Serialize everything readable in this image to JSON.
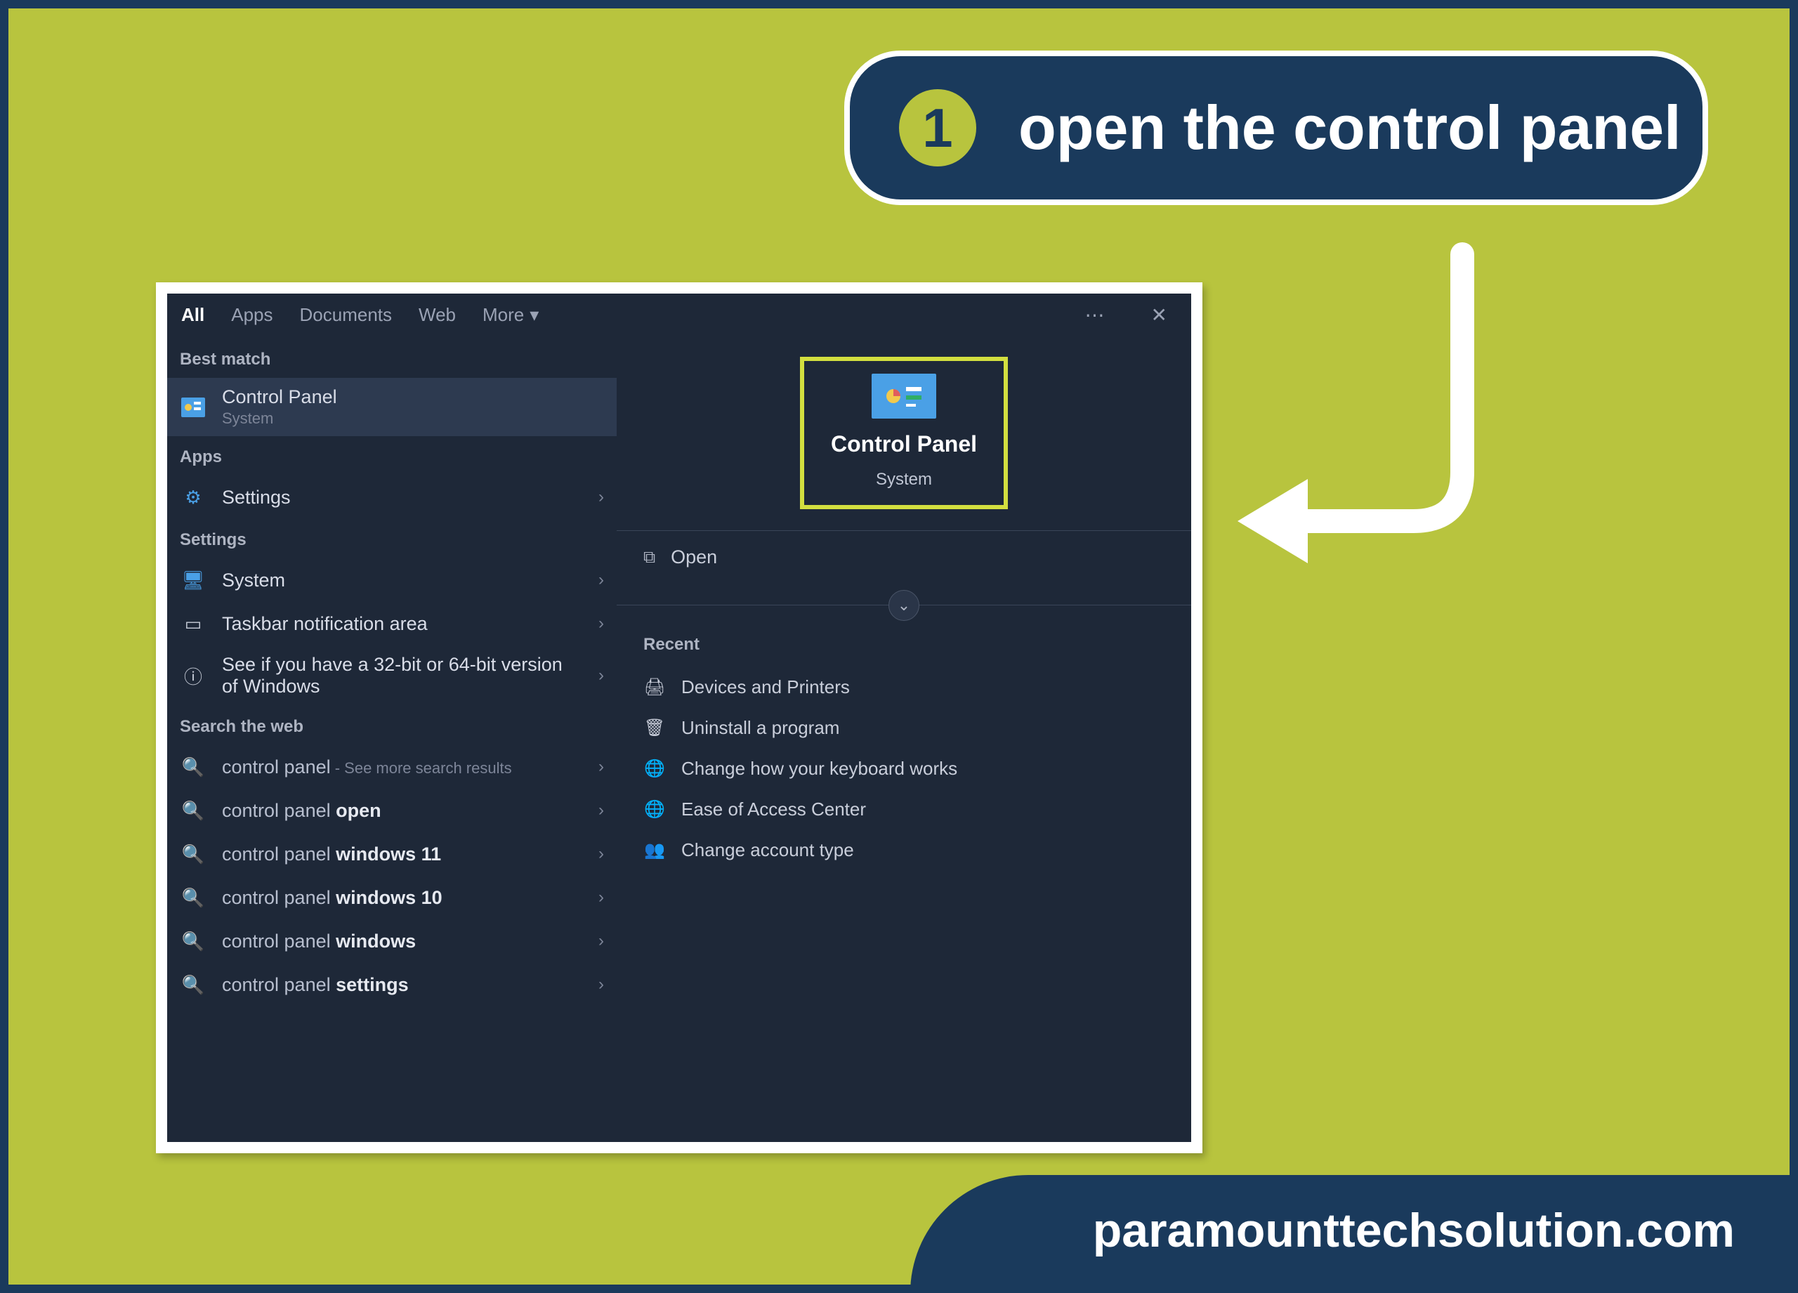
{
  "callout": {
    "step": "1",
    "text": "open the control panel"
  },
  "footer": "paramounttechsolution.com",
  "colors": {
    "brand_navy": "#1a3a5c",
    "brand_green": "#b8c43e",
    "highlight": "#d3df3f",
    "panel_bg": "#1e2838"
  },
  "search": {
    "tabs": {
      "all": "All",
      "apps": "Apps",
      "documents": "Documents",
      "web": "Web",
      "more": "More"
    },
    "section_best_match": "Best match",
    "section_apps": "Apps",
    "section_settings": "Settings",
    "section_web": "Search the web",
    "best_match": {
      "title": "Control Panel",
      "subtitle": "System",
      "icon": "control-panel-icon"
    },
    "apps": [
      {
        "title": "Settings",
        "icon": "gear-icon"
      }
    ],
    "settings": [
      {
        "title": "System",
        "icon": "monitor-icon"
      },
      {
        "title": "Taskbar notification area",
        "icon": "taskbar-icon"
      },
      {
        "title": "See if you have a 32-bit or 64-bit version of Windows",
        "icon": "info-icon"
      }
    ],
    "web": [
      {
        "prefix": "control panel",
        "suffix": "",
        "hint": " - See more search results"
      },
      {
        "prefix": "control panel ",
        "suffix": "open",
        "hint": ""
      },
      {
        "prefix": "control panel ",
        "suffix": "windows 11",
        "hint": ""
      },
      {
        "prefix": "control panel ",
        "suffix": "windows 10",
        "hint": ""
      },
      {
        "prefix": "control panel ",
        "suffix": "windows",
        "hint": ""
      },
      {
        "prefix": "control panel ",
        "suffix": "settings",
        "hint": ""
      }
    ],
    "preview": {
      "title": "Control Panel",
      "subtitle": "System",
      "action_open": "Open",
      "recent_label": "Recent",
      "recent": [
        {
          "label": "Devices and Printers",
          "icon": "printer-icon"
        },
        {
          "label": "Uninstall a program",
          "icon": "uninstall-icon"
        },
        {
          "label": "Change how your keyboard works",
          "icon": "globe-icon"
        },
        {
          "label": "Ease of Access Center",
          "icon": "globe-icon"
        },
        {
          "label": "Change account type",
          "icon": "user-icon"
        }
      ]
    }
  }
}
